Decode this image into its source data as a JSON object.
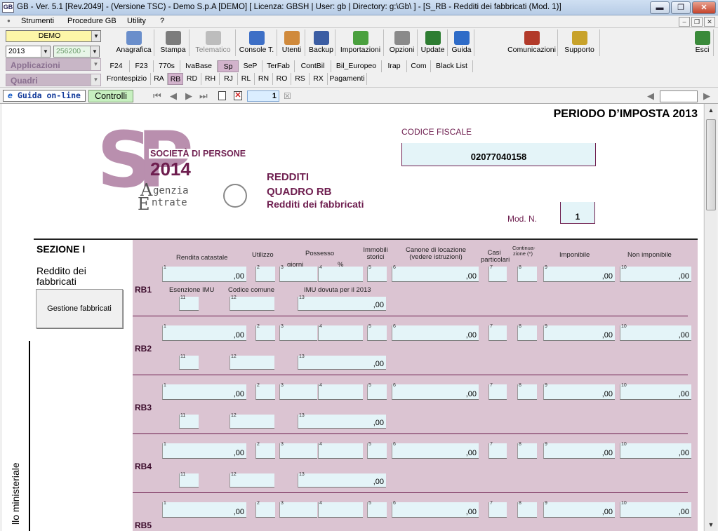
{
  "window": {
    "icon_text": "GB",
    "title": "GB - Ver. 5.1 [Rev.2049] - (Versione TSC) - Demo S.p.A [DEMO]    [ Licenza: GBSH | User: gb | Directory: g:\\Gb\\ ] - [S_RB - Redditi dei fabbricati (Mod. 1)]",
    "min": "▬",
    "max": "❐",
    "close": "✕"
  },
  "menu": {
    "items": [
      "Strumenti",
      "Procedure GB",
      "Utility",
      "?"
    ],
    "mdi": [
      "–",
      "❐",
      "✕"
    ],
    "bullet": "●"
  },
  "left": {
    "company": "DEMO",
    "year": "2013",
    "code": "256200 -",
    "applicazioni": "Applicazioni",
    "quadri": "Quadri"
  },
  "toolbar": [
    {
      "label": "Anagrafica",
      "icon": "id-card-icon",
      "color": "#6a8ecb"
    },
    {
      "label": "Stampa",
      "icon": "printer-icon",
      "color": "#7c7c7c"
    },
    {
      "label": "Telematico",
      "icon": "telematico-icon",
      "color": "#bdbdbd",
      "disabled": true
    },
    {
      "label": "Console T.",
      "icon": "console-icon",
      "color": "#3d6fc6"
    },
    {
      "label": "Utenti",
      "icon": "users-icon",
      "color": "#d08a3c"
    },
    {
      "label": "Backup",
      "icon": "backup-icon",
      "color": "#3b5da3"
    },
    {
      "label": "Importazioni",
      "icon": "import-icon",
      "color": "#4aa03e"
    },
    {
      "label": "Opzioni",
      "icon": "wrench-icon",
      "color": "#8a8a8a"
    },
    {
      "label": "Update",
      "icon": "update-icon",
      "color": "#2e7d32"
    },
    {
      "label": "Guida",
      "icon": "help-icon",
      "color": "#2f6cc8"
    },
    {
      "label": "Comunicazioni",
      "icon": "comunicazioni-icon",
      "color": "#b23a2a"
    },
    {
      "label": "Supporto",
      "icon": "support-icon",
      "color": "#c8a22a"
    },
    {
      "label": "Esci",
      "icon": "exit-icon",
      "color": "#3a8a3a"
    }
  ],
  "tabs1": [
    "F24",
    "F23",
    "770s",
    "IvaBase",
    "Sp",
    "SeP",
    "TerFab",
    "ContBil",
    "Bil_Europeo",
    "Irap",
    "Com",
    "Black List"
  ],
  "tabs2": [
    "Frontespizio",
    "RA",
    "RB",
    "RD",
    "RH",
    "RJ",
    "RL",
    "RN",
    "RO",
    "RS",
    "RX",
    "Pagamenti"
  ],
  "nav": {
    "guida": "Guida on-line",
    "controlli": "Controlli",
    "page": "1",
    "first": "⏮",
    "prev": "◀",
    "next": "▶",
    "last": "⏭",
    "back": "◀",
    "ie": "e"
  },
  "doc": {
    "periodo": "PERIODO D’IMPOSTA 2013",
    "logo_letters": "SP",
    "logo_line1": "SOCIETÀ DI PERSONE",
    "logo_line2": "2014",
    "agenzia": "genzia",
    "entrate": "ntrate",
    "logo_a": "A",
    "logo_e": "E",
    "codice_fiscale_label": "CODICE FISCALE",
    "codice_fiscale": "02077040158",
    "redditi": "REDDITI",
    "quadro": "QUADRO RB",
    "quadro_sub": "Redditi dei fabbricati",
    "mod_label": "Mod. N.",
    "mod_value": "1",
    "sezione": "SEZIONE I",
    "sezione_sub": "Reddito dei fabbricati",
    "gestione": "Gestione fabbricati",
    "side_vertical": "llo ministeriale",
    "headers": {
      "rendita": "Rendita catastale",
      "utilizzo": "Utilizzo",
      "possesso": "Possesso",
      "giorni": "giorni",
      "perc": "%",
      "immobili": "Immobili storici",
      "canone": "Canone di locazione (vedere istruzioni)",
      "casi": "Casi particolari",
      "continuazione": "Continua- zione (*)",
      "imponibile": "Imponibile",
      "non_imponibile": "Non imponibile"
    },
    "sub_headers": {
      "esenzione": "Esenzione IMU",
      "codice_comune": "Codice comune",
      "imu": "IMU dovuta per il 2013"
    },
    "zero": ",00",
    "rows": [
      "RB1",
      "RB2",
      "RB3",
      "RB4",
      "RB5"
    ]
  }
}
